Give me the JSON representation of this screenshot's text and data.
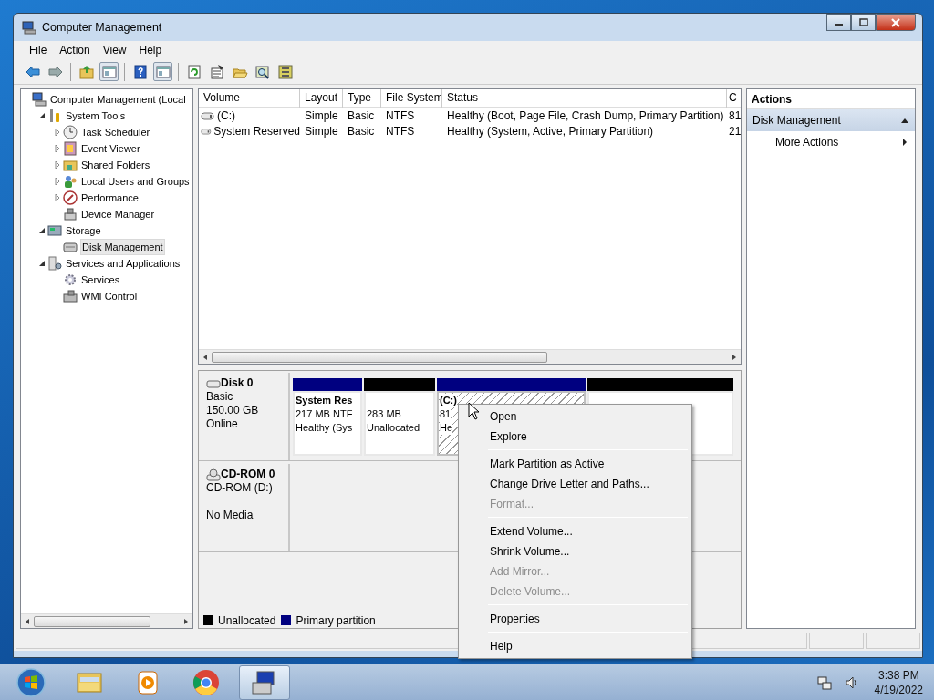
{
  "window": {
    "title": "Computer Management"
  },
  "menu": [
    "File",
    "Action",
    "View",
    "Help"
  ],
  "toolbar": [
    {
      "kind": "back",
      "pressed": false
    },
    {
      "kind": "forward",
      "pressed": false
    },
    {
      "kind": "separator"
    },
    {
      "kind": "up",
      "pressed": false
    },
    {
      "kind": "pane",
      "pressed": true
    },
    {
      "kind": "separator"
    },
    {
      "kind": "help",
      "pressed": false
    },
    {
      "kind": "pane",
      "pressed": true
    },
    {
      "kind": "separator"
    },
    {
      "kind": "refresh",
      "pressed": false
    },
    {
      "kind": "properties",
      "pressed": false
    },
    {
      "kind": "open",
      "pressed": false
    },
    {
      "kind": "find",
      "pressed": false
    },
    {
      "kind": "settings",
      "pressed": false
    }
  ],
  "tree": [
    {
      "label": "Computer Management (Local",
      "kind": "computer",
      "selected": false,
      "children": [
        {
          "label": "System Tools",
          "kind": "tools",
          "expanded": true,
          "selected": false,
          "children": [
            {
              "label": "Task Scheduler",
              "kind": "clock",
              "expanded": false,
              "selected": false
            },
            {
              "label": "Event Viewer",
              "kind": "log",
              "expanded": false,
              "selected": false
            },
            {
              "label": "Shared Folders",
              "kind": "share",
              "expanded": false,
              "selected": false
            },
            {
              "label": "Local Users and Groups",
              "kind": "users",
              "expanded": false,
              "selected": false
            },
            {
              "label": "Performance",
              "kind": "gauge",
              "expanded": false,
              "selected": false
            },
            {
              "label": "Device Manager",
              "kind": "device",
              "selected": false
            }
          ]
        },
        {
          "label": "Storage",
          "kind": "storage",
          "expanded": true,
          "selected": false,
          "children": [
            {
              "label": "Disk Management",
              "kind": "disk",
              "selected": true
            }
          ]
        },
        {
          "label": "Services and Applications",
          "kind": "services",
          "expanded": true,
          "selected": false,
          "children": [
            {
              "label": "Services",
              "kind": "gear",
              "selected": false
            },
            {
              "label": "WMI Control",
              "kind": "wmi",
              "selected": false
            }
          ]
        }
      ]
    }
  ],
  "volumes": {
    "columns": [
      "Volume",
      "Layout",
      "Type",
      "File System",
      "Status",
      "C"
    ],
    "rows": [
      [
        "(C:)",
        "Simple",
        "Basic",
        "NTFS",
        "Healthy (Boot, Page File, Crash Dump, Primary Partition)",
        "81"
      ],
      [
        "System Reserved",
        "Simple",
        "Basic",
        "NTFS",
        "Healthy (System, Active, Primary Partition)",
        "21"
      ]
    ]
  },
  "disks": [
    {
      "name": "Disk 0",
      "kind": "disk",
      "type": "Basic",
      "size": "150.00 GB",
      "status": "Online",
      "partitions": [
        {
          "name": "System Res",
          "lines": [
            "217 MB NTF",
            "Healthy (Sys"
          ],
          "color": "#000080",
          "selected": false
        },
        {
          "lines": [
            "283 MB",
            "Unallocated"
          ],
          "color": "#000000",
          "selected": false
        },
        {
          "name": "(C:)",
          "lines": [
            "81",
            "He"
          ],
          "color": "#000080",
          "selected": true
        },
        {
          "color": "#000000",
          "selected": false
        }
      ]
    },
    {
      "name": "CD-ROM 0",
      "kind": "cdrom",
      "type": "CD-ROM (D:)",
      "status": "No Media"
    }
  ],
  "legend": [
    {
      "label": "Unallocated",
      "color": "#000000"
    },
    {
      "label": "Primary partition",
      "color": "#000080"
    }
  ],
  "actions": {
    "title": "Actions",
    "section": "Disk Management",
    "expanded": true,
    "items": [
      "More Actions"
    ]
  },
  "context_menu": [
    {
      "kind": "item",
      "label": "Open",
      "disabled": false
    },
    {
      "kind": "item",
      "label": "Explore",
      "disabled": false
    },
    {
      "kind": "separator"
    },
    {
      "kind": "item",
      "label": "Mark Partition as Active",
      "disabled": false
    },
    {
      "kind": "item",
      "label": "Change Drive Letter and Paths...",
      "disabled": false
    },
    {
      "kind": "item",
      "label": "Format...",
      "disabled": true
    },
    {
      "kind": "separator"
    },
    {
      "kind": "item",
      "label": "Extend Volume...",
      "disabled": false
    },
    {
      "kind": "item",
      "label": "Shrink Volume...",
      "disabled": false
    },
    {
      "kind": "item",
      "label": "Add Mirror...",
      "disabled": true
    },
    {
      "kind": "item",
      "label": "Delete Volume...",
      "disabled": true
    },
    {
      "kind": "separator"
    },
    {
      "kind": "item",
      "label": "Properties",
      "disabled": false
    },
    {
      "kind": "separator"
    },
    {
      "kind": "item",
      "label": "Help",
      "disabled": false
    }
  ],
  "taskbar": {
    "buttons": [
      {
        "kind": "start",
        "selected": false
      },
      {
        "kind": "explorer",
        "selected": false
      },
      {
        "kind": "media",
        "selected": false
      },
      {
        "kind": "browser",
        "selected": false
      },
      {
        "kind": "management",
        "selected": true
      }
    ],
    "time": "3:38 PM",
    "date": "4/19/2022"
  }
}
